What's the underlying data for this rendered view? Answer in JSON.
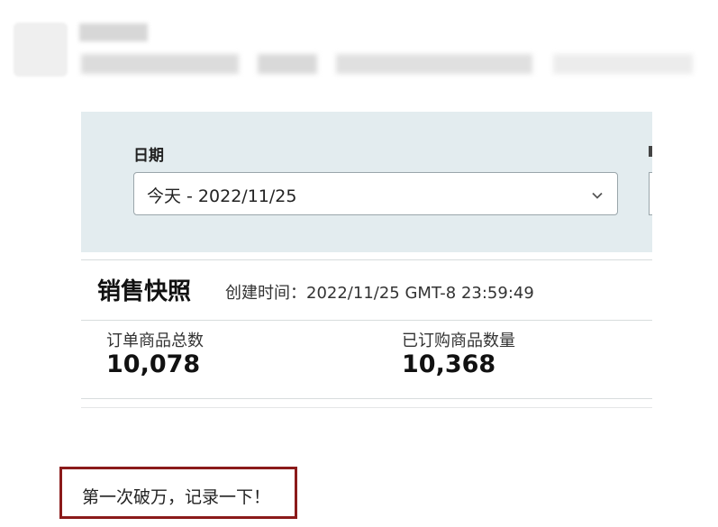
{
  "post": {
    "caption": "第一次破万，记录一下！"
  },
  "screenshot": {
    "date_filter": {
      "label": "日期",
      "selected_value": "今天 - 2022/11/25"
    },
    "sales_snapshot": {
      "title": "销售快照",
      "created_time": "创建时间：2022/11/25 GMT-8 23:59:49"
    },
    "metrics": [
      {
        "label": "订单商品总数",
        "value": "10,078"
      },
      {
        "label": "已订购商品数量",
        "value": "10,368"
      }
    ]
  },
  "colors": {
    "panel_background": "#e3ecef",
    "caption_border": "#8b1a1a"
  },
  "icons": {
    "dropdown": "chevron-down-icon"
  }
}
